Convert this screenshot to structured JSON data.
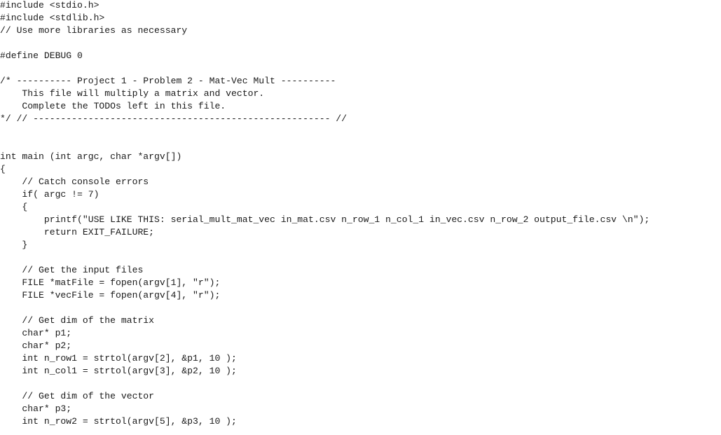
{
  "editor": {
    "language": "c",
    "lines": [
      "#include <stdio.h>",
      "#include <stdlib.h>",
      "// Use more libraries as necessary",
      "",
      "#define DEBUG 0",
      "",
      "/* ---------- Project 1 - Problem 2 - Mat-Vec Mult ----------",
      "    This file will multiply a matrix and vector.",
      "    Complete the TODOs left in this file.",
      "*/ // ------------------------------------------------------ //",
      "",
      "",
      "int main (int argc, char *argv[])",
      "{",
      "    // Catch console errors",
      "    if( argc != 7)",
      "    {",
      "        printf(\"USE LIKE THIS: serial_mult_mat_vec in_mat.csv n_row_1 n_col_1 in_vec.csv n_row_2 output_file.csv \\n\");",
      "        return EXIT_FAILURE;",
      "    }",
      "",
      "    // Get the input files",
      "    FILE *matFile = fopen(argv[1], \"r\");",
      "    FILE *vecFile = fopen(argv[4], \"r\");",
      "",
      "    // Get dim of the matrix",
      "    char* p1;",
      "    char* p2;",
      "    int n_row1 = strtol(argv[2], &p1, 10 );",
      "    int n_col1 = strtol(argv[3], &p2, 10 );",
      "",
      "    // Get dim of the vector",
      "    char* p3;",
      "    int n_row2 = strtol(argv[5], &p3, 10 );"
    ]
  }
}
